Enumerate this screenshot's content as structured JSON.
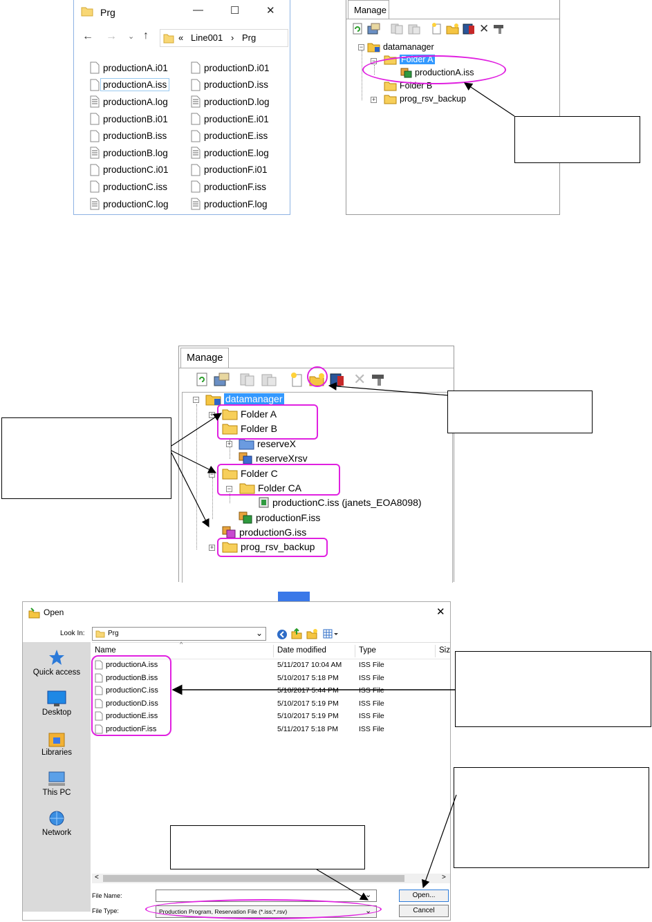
{
  "explorer": {
    "title": "Prg",
    "breadcrumb": [
      "«",
      "Line001",
      "›",
      "Prg"
    ],
    "files_left": [
      "productionA.i01",
      "productionA.iss",
      "productionA.log",
      "productionB.i01",
      "productionB.iss",
      "productionB.log",
      "productionC.i01",
      "productionC.iss",
      "productionC.log"
    ],
    "files_right": [
      "productionD.i01",
      "productionD.iss",
      "productionD.log",
      "productionE.i01",
      "productionE.iss",
      "productionE.log",
      "productionF.i01",
      "productionF.iss",
      "productionF.log"
    ],
    "selected_file": "productionA.iss"
  },
  "manage1": {
    "tab": "Manage",
    "root": "datamanager",
    "folder_a": "Folder A",
    "file_a": "productionA.iss",
    "folder_b": "Folder B",
    "backup": "prog_rsv_backup"
  },
  "manage2": {
    "tab": "Manage",
    "root": "datamanager",
    "folder_a": "Folder A",
    "folder_b": "Folder B",
    "reserve_x": "reserveX",
    "reserve_x_rsv": "reserveXrsv",
    "folder_c": "Folder C",
    "folder_ca": "Folder CA",
    "production_c": "productionC.iss (janets_EOA8098)",
    "production_f": "productionF.iss",
    "production_g": "productionG.iss",
    "backup": "prog_rsv_backup"
  },
  "open_dialog": {
    "title": "Open",
    "look_in_label": "Look In:",
    "look_in_value": "Prg",
    "columns": [
      "Name",
      "Date modified",
      "Type",
      "Siz"
    ],
    "rows": [
      {
        "name": "productionA.iss",
        "date": "5/11/2017 10:04 AM",
        "type": "ISS File"
      },
      {
        "name": "productionB.iss",
        "date": "5/10/2017 5:18 PM",
        "type": "ISS File"
      },
      {
        "name": "productionC.iss",
        "date": "5/10/2017 5:44 PM",
        "type": "ISS File"
      },
      {
        "name": "productionD.iss",
        "date": "5/10/2017 5:19 PM",
        "type": "ISS File"
      },
      {
        "name": "productionE.iss",
        "date": "5/10/2017 5:19 PM",
        "type": "ISS File"
      },
      {
        "name": "productionF.iss",
        "date": "5/11/2017 5:18 PM",
        "type": "ISS File"
      }
    ],
    "sidebar": [
      "Quick access",
      "Desktop",
      "Libraries",
      "This PC",
      "Network"
    ],
    "file_name_label": "File Name:",
    "file_name_value": "",
    "file_type_label": "File Type:",
    "file_type_value": "Production Program, Reservation File (*.iss;*.rsv)",
    "open_button": "Open...",
    "cancel_button": "Cancel"
  },
  "colors": {
    "highlight": "#e020e0",
    "selection": "#3399ff",
    "arrow": "#3a78e8"
  }
}
